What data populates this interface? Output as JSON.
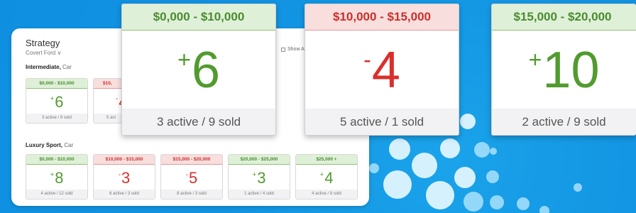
{
  "strategy": {
    "title": "Strategy",
    "subtitle": "Covert Ford",
    "show_all_label": "Show A"
  },
  "sections": [
    {
      "name": "Intermediate,",
      "kind": "Car",
      "cards": [
        {
          "range": "$0,000 - $10,000",
          "sign": "+",
          "value": "6",
          "footer": "3 active / 9 sold",
          "status": "g"
        },
        {
          "range": "$10,",
          "sign": "-",
          "value": "4",
          "footer": "5 act",
          "status": "r"
        }
      ]
    },
    {
      "name": "Luxury Sport,",
      "kind": "Car",
      "cards": [
        {
          "range": "$0,000 - $10,000",
          "sign": "+",
          "value": "8",
          "footer": "4 active / 12 sold",
          "status": "g"
        },
        {
          "range": "$10,000 - $15,000",
          "sign": "-",
          "value": "3",
          "footer": "6 active / 3 sold",
          "status": "r"
        },
        {
          "range": "$15,000 - $20,000",
          "sign": "-",
          "value": "5",
          "footer": "8 active / 3 sold",
          "status": "r"
        },
        {
          "range": "$20,000 - $25,000",
          "sign": "+",
          "value": "3",
          "footer": "1 active / 4 sold",
          "status": "g"
        },
        {
          "range": "$25,000 +",
          "sign": "+",
          "value": "4",
          "footer": "4 active / 8 sold",
          "status": "g"
        }
      ]
    }
  ],
  "featured": [
    {
      "range": "$0,000 - $10,000",
      "sign": "+",
      "value": "6",
      "footer": "3 active / 9 sold",
      "status": "g"
    },
    {
      "range": "$10,000 - $15,000",
      "sign": "-",
      "value": "4",
      "footer": "5 active / 1 sold",
      "status": "r"
    },
    {
      "range": "$15,000 - $20,000",
      "sign": "+",
      "value": "10",
      "footer": "2 active / 9 sold",
      "status": "g"
    }
  ],
  "colors": {
    "positive": "#529b2f",
    "negative": "#d9302c",
    "positive_header_bg": "#dff0d8",
    "negative_header_bg": "#f8dedd",
    "background": "#1597e4"
  }
}
